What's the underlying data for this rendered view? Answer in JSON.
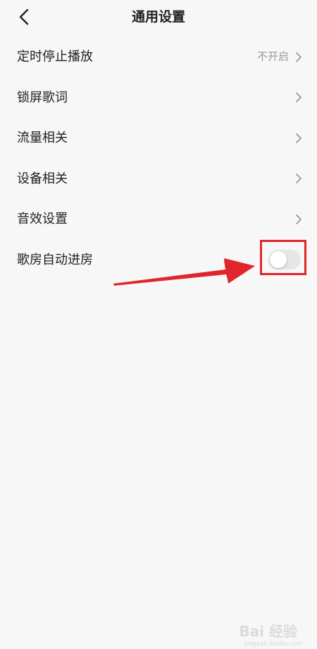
{
  "header": {
    "title": "通用设置",
    "back_icon": "chevron-left-icon"
  },
  "settings": {
    "items": [
      {
        "label": "定时停止播放",
        "value": "不开启",
        "control": "chevron"
      },
      {
        "label": "锁屏歌词",
        "value": "",
        "control": "chevron"
      },
      {
        "label": "流量相关",
        "value": "",
        "control": "chevron"
      },
      {
        "label": "设备相关",
        "value": "",
        "control": "chevron"
      },
      {
        "label": "音效设置",
        "value": "",
        "control": "chevron"
      },
      {
        "label": "歌房自动进房",
        "value": "",
        "control": "toggle",
        "toggle_on": false
      }
    ]
  },
  "annotation": {
    "highlight_color": "#e0262c"
  },
  "watermark": {
    "text": "Bai 经验",
    "subtext": "jingyan.baidu.com"
  },
  "colors": {
    "background": "#f7f7f7",
    "text": "#222222",
    "secondary_text": "#999999",
    "toggle_off": "#e6e6e6"
  }
}
